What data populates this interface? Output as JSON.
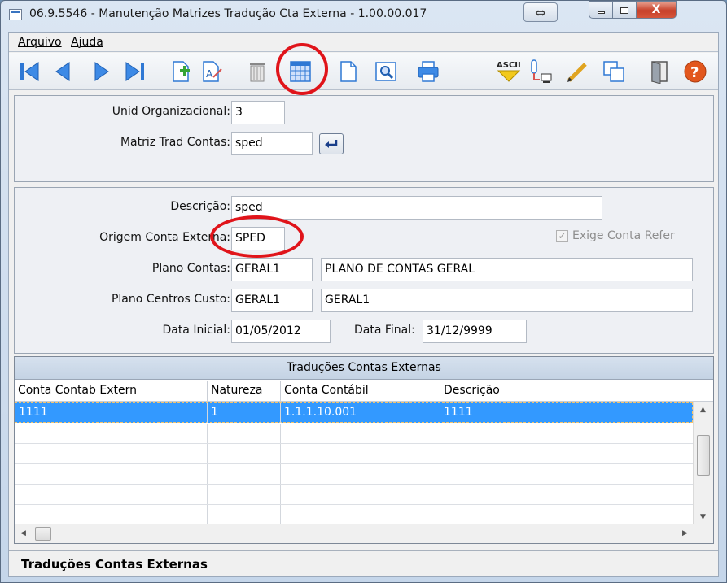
{
  "window": {
    "title": "06.9.5546 - Manutenção Matrizes Tradução Cta Externa - 1.00.00.017",
    "restore_glyph": "⇔",
    "close_glyph": "X"
  },
  "menu": [
    "Arquivo",
    "Ajuda"
  ],
  "toolbar": {
    "icons": [
      "first-icon",
      "previous-icon",
      "next-icon",
      "last-icon",
      "new-record-icon",
      "edit-icon",
      "delete-icon",
      "grid-view-icon",
      "document-icon",
      "preview-icon",
      "print-icon",
      "ascii-export-icon",
      "export-icon",
      "pencil-icon",
      "copy-icon",
      "exit-door-icon",
      "help-icon"
    ],
    "ascii_label": "ASCII",
    "help_label": "?"
  },
  "header": {
    "unid_org_label": "Unid Organizacional:",
    "unid_org_value": "3",
    "matriz_label": "Matriz Trad Contas:",
    "matriz_value": "sped"
  },
  "details": {
    "descricao_label": "Descrição:",
    "descricao_value": "sped",
    "origem_label": "Origem Conta Externa:",
    "origem_value": "SPED",
    "exige_label": "Exige Conta Refer",
    "exige_checked": true,
    "plano_contas_label": "Plano Contas:",
    "plano_contas_code": "GERAL1",
    "plano_contas_desc": "PLANO DE CONTAS GERAL",
    "plano_cc_label": "Plano Centros Custo:",
    "plano_cc_code": "GERAL1",
    "plano_cc_desc": "GERAL1",
    "data_inicial_label": "Data Inicial:",
    "data_inicial_value": "01/05/2012",
    "data_final_label": "Data Final:",
    "data_final_value": "31/12/9999"
  },
  "grid": {
    "title": "Traduções Contas Externas",
    "columns": [
      "Conta Contab Extern",
      "Natureza",
      "Conta Contábil",
      "Descrição"
    ],
    "rows": [
      [
        "1111",
        "1",
        "1.1.1.10.001",
        "1111"
      ]
    ]
  },
  "status": "Traduções Contas Externas",
  "colors": {
    "highlight": "#e0141a",
    "selection": "#3399ff"
  }
}
